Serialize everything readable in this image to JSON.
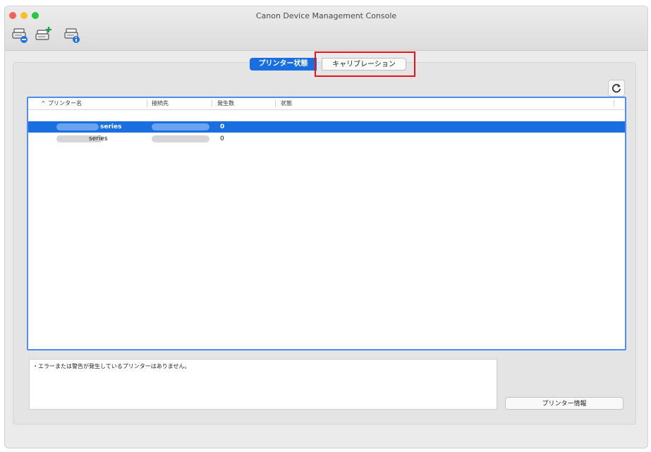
{
  "window": {
    "title": "Canon Device Management Console"
  },
  "toolbar": {
    "buttons": [
      "printer-remove-icon",
      "printer-add-icon",
      "printer-info-icon"
    ]
  },
  "tabs": [
    {
      "label": "プリンター状態",
      "selected": true
    },
    {
      "label": "キャリブレーション",
      "selected": false
    }
  ],
  "table": {
    "columns": [
      "プリンター名",
      "接続先",
      "発生数",
      "状態"
    ],
    "rows": [
      {
        "name": "series",
        "connection": "",
        "count": "0",
        "status": "",
        "selected": true
      },
      {
        "name": "series",
        "connection": "",
        "count": "0",
        "status": "",
        "selected": false
      }
    ]
  },
  "message": "・エラーまたは警告が発生しているプリンターはありません。",
  "buttons": {
    "printer_info": "プリンター情報"
  },
  "colors": {
    "accent": "#1a6fe0",
    "highlight": "#e8141a",
    "table_border": "#4d8ef0"
  }
}
